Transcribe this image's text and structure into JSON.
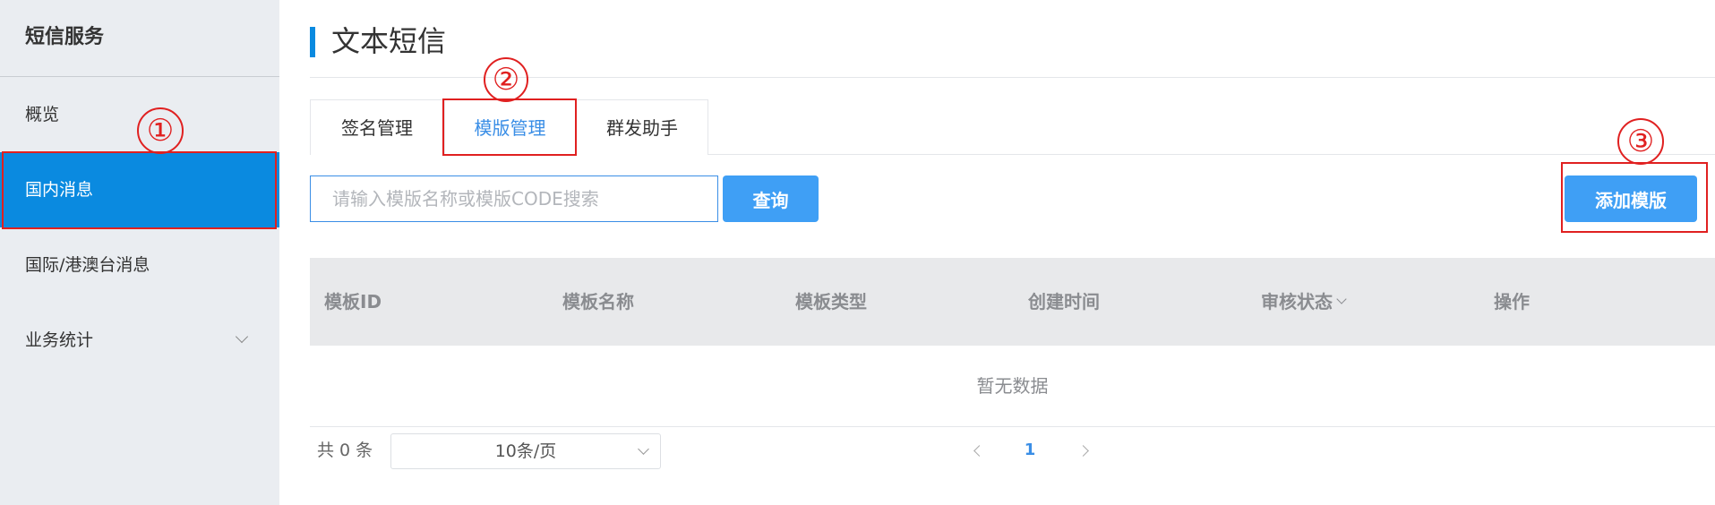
{
  "sidebar": {
    "title": "短信服务",
    "items": [
      {
        "label": "概览"
      },
      {
        "label": "国内消息"
      },
      {
        "label": "国际/港澳台消息"
      },
      {
        "label": "业务统计"
      }
    ]
  },
  "page": {
    "title": "文本短信"
  },
  "tabs": [
    {
      "label": "签名管理"
    },
    {
      "label": "模版管理"
    },
    {
      "label": "群发助手"
    }
  ],
  "search": {
    "placeholder": "请输入模版名称或模版CODE搜索",
    "value": ""
  },
  "buttons": {
    "query": "查询",
    "add_template": "添加模版"
  },
  "table": {
    "columns": [
      "模板ID",
      "模板名称",
      "模板类型",
      "创建时间",
      "审核状态",
      "操作"
    ],
    "empty_text": "暂无数据"
  },
  "pagination": {
    "total": "共 0 条",
    "page_size": "10条/页",
    "current_page": "1"
  },
  "annotations": [
    "①",
    "②",
    "③"
  ],
  "colors": {
    "accent": "#0a8ae0",
    "button": "#3f9ff5",
    "annotation": "#e02020"
  }
}
